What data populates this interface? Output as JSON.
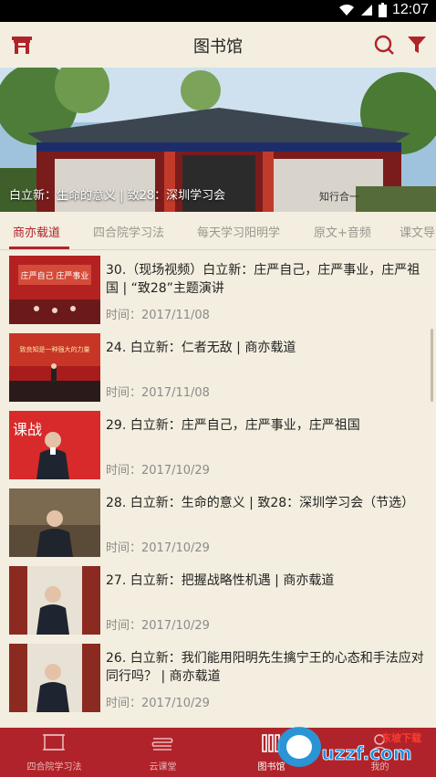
{
  "status": {
    "time": "12:07"
  },
  "header": {
    "title": "图书馆",
    "left_icon": "home-gate-icon",
    "search_icon": "search-icon",
    "filter_icon": "filter-icon"
  },
  "banner": {
    "caption": "白立新：生命的意义 | 致28：深圳学习会",
    "plaque_text": "知行合一"
  },
  "tabs": [
    {
      "label": "商亦载道",
      "active": true
    },
    {
      "label": "四合院学习法",
      "active": false
    },
    {
      "label": "每天学习阳明学",
      "active": false
    },
    {
      "label": "原文+音频",
      "active": false
    },
    {
      "label": "课文导",
      "active": false
    }
  ],
  "items": [
    {
      "title": "30.（现场视频）白立新：庄严自己，庄严事业，庄严祖国 | “致28”主题演讲",
      "time": "时间：2017/11/08",
      "thumb_text": "庄严自己 庄严事业"
    },
    {
      "title": "24. 白立新：仁者无敌 | 商亦载道",
      "time": "时间：2017/11/08",
      "thumb_text": "致良知是一种强大的力量"
    },
    {
      "title": "29. 白立新：庄严自己，庄严事业，庄严祖国",
      "time": "时间：2017/10/29",
      "thumb_text": "课战"
    },
    {
      "title": "28. 白立新：生命的意义 | 致28：深圳学习会（节选）",
      "time": "时间：2017/10/29",
      "thumb_text": ""
    },
    {
      "title": "27. 白立新：把握战略性机遇 | 商亦载道",
      "time": "时间：2017/10/29",
      "thumb_text": ""
    },
    {
      "title": "26. 白立新：我们能用阳明先生擒宁王的心态和手法应对同行吗？ | 商亦载道",
      "time": "时间：2017/10/29",
      "thumb_text": ""
    }
  ],
  "bottom_nav": [
    {
      "label": "四合院学习法",
      "icon": "courtyard-icon",
      "active": false
    },
    {
      "label": "云课堂",
      "icon": "cloud-class-icon",
      "active": false
    },
    {
      "label": "图书馆",
      "icon": "library-icon",
      "active": true
    },
    {
      "label": "我的",
      "icon": "profile-icon",
      "active": false
    }
  ],
  "watermark": {
    "text": "uzzf.com",
    "subtext": "东坡下载"
  },
  "colors": {
    "accent": "#b1232a",
    "background": "#f3eedf"
  }
}
